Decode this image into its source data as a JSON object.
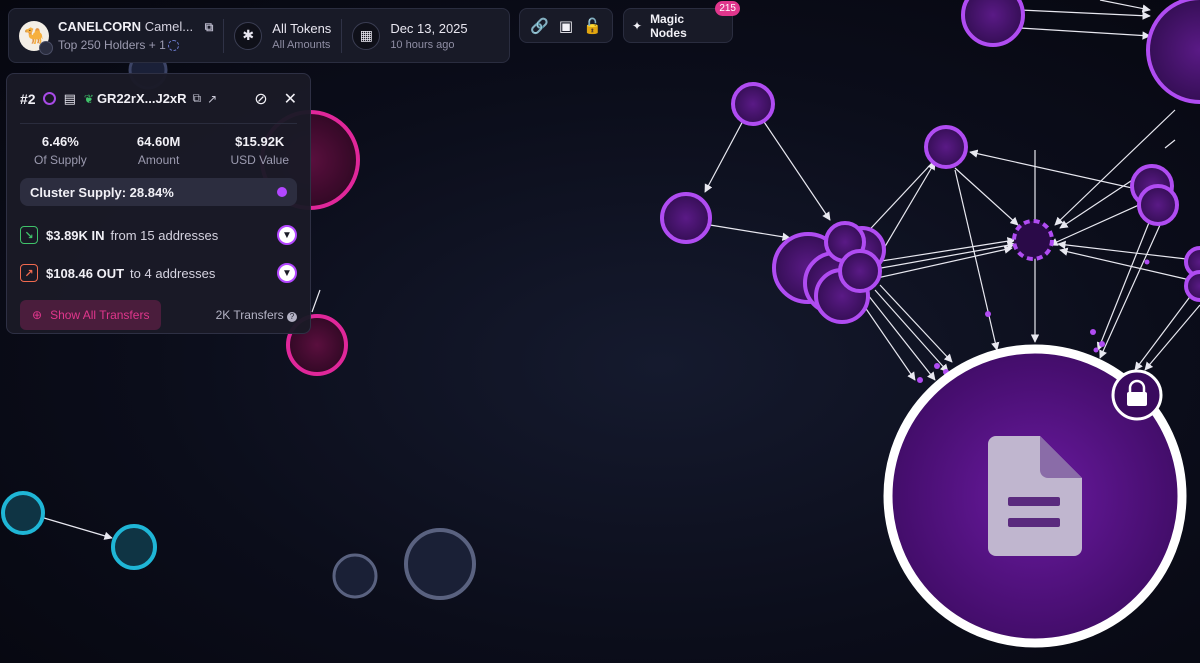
{
  "header": {
    "token_name": "CANELCORN",
    "token_desc": "Camel...",
    "holders_label": "Top 250 Holders + 1",
    "tokens_title": "All Tokens",
    "tokens_sub": "All Amounts",
    "date": "Dec 13, 2025",
    "date_rel": "10 hours ago"
  },
  "toolbar": {
    "magic_label": "Magic Nodes",
    "magic_count": "215",
    "icons": [
      "link-icon",
      "save-icon",
      "unlock-icon"
    ]
  },
  "panel": {
    "rank": "#2",
    "address": "GR22rX...J2xR",
    "stats": [
      {
        "value": "6.46%",
        "label": "Of Supply"
      },
      {
        "value": "64.60M",
        "label": "Amount"
      },
      {
        "value": "$15.92K",
        "label": "USD Value"
      }
    ],
    "cluster_label": "Cluster Supply: 28.84%",
    "in": {
      "amount": "$3.89K IN",
      "rest": "from 15 addresses"
    },
    "out": {
      "amount": "$108.46 OUT",
      "rest": "to 4 addresses"
    },
    "show_transfers": "Show All Transfers",
    "transfers_count": "2K Transfers"
  },
  "colors": {
    "purple": "#a74ae6",
    "magenta": "#e0368c",
    "cyan": "#1fb6d6",
    "slate": "#5a6280",
    "green": "#3fc26a",
    "orange": "#f06a4f"
  }
}
